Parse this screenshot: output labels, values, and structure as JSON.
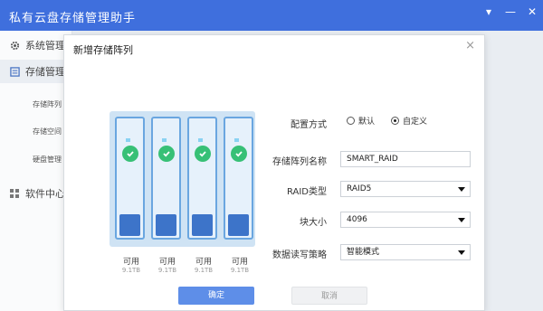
{
  "app": {
    "title": "私有云盘存储管理助手"
  },
  "window_controls": [
    "▾",
    "—",
    "✕"
  ],
  "sidebar": {
    "items": [
      {
        "label": "系统管理",
        "icon": "gear-icon"
      },
      {
        "label": "存储管理",
        "icon": "storage-icon"
      },
      {
        "label": "软件中心",
        "icon": "grid-icon"
      }
    ],
    "sub_items": [
      "存储阵列",
      "存储空间",
      "硬盘管理"
    ]
  },
  "dialog": {
    "title": "新增存储阵列",
    "close": "×",
    "disks": [
      {
        "status": "可用",
        "size": "9.1TB"
      },
      {
        "status": "可用",
        "size": "9.1TB"
      },
      {
        "status": "可用",
        "size": "9.1TB"
      },
      {
        "status": "可用",
        "size": "9.1TB"
      }
    ],
    "form": {
      "config_mode_label": "配置方式",
      "config_options": [
        "默认",
        "自定义"
      ],
      "config_selected": "自定义",
      "name_label": "存储阵列名称",
      "name_value": "SMART_RAID",
      "raid_type_label": "RAID类型",
      "raid_type_value": "RAID5",
      "block_size_label": "块大小",
      "block_size_value": "4096",
      "rw_policy_label": "数据读写策略",
      "rw_policy_value": "智能模式"
    },
    "buttons": {
      "ok": "确定",
      "cancel": "取消"
    }
  },
  "colors": {
    "titlebar": "#3f6fdd",
    "primary_button": "#5e8ee8",
    "check": "#37c076",
    "disk_border": "#6aa6e0",
    "disk_slot": "#3d74c9"
  }
}
